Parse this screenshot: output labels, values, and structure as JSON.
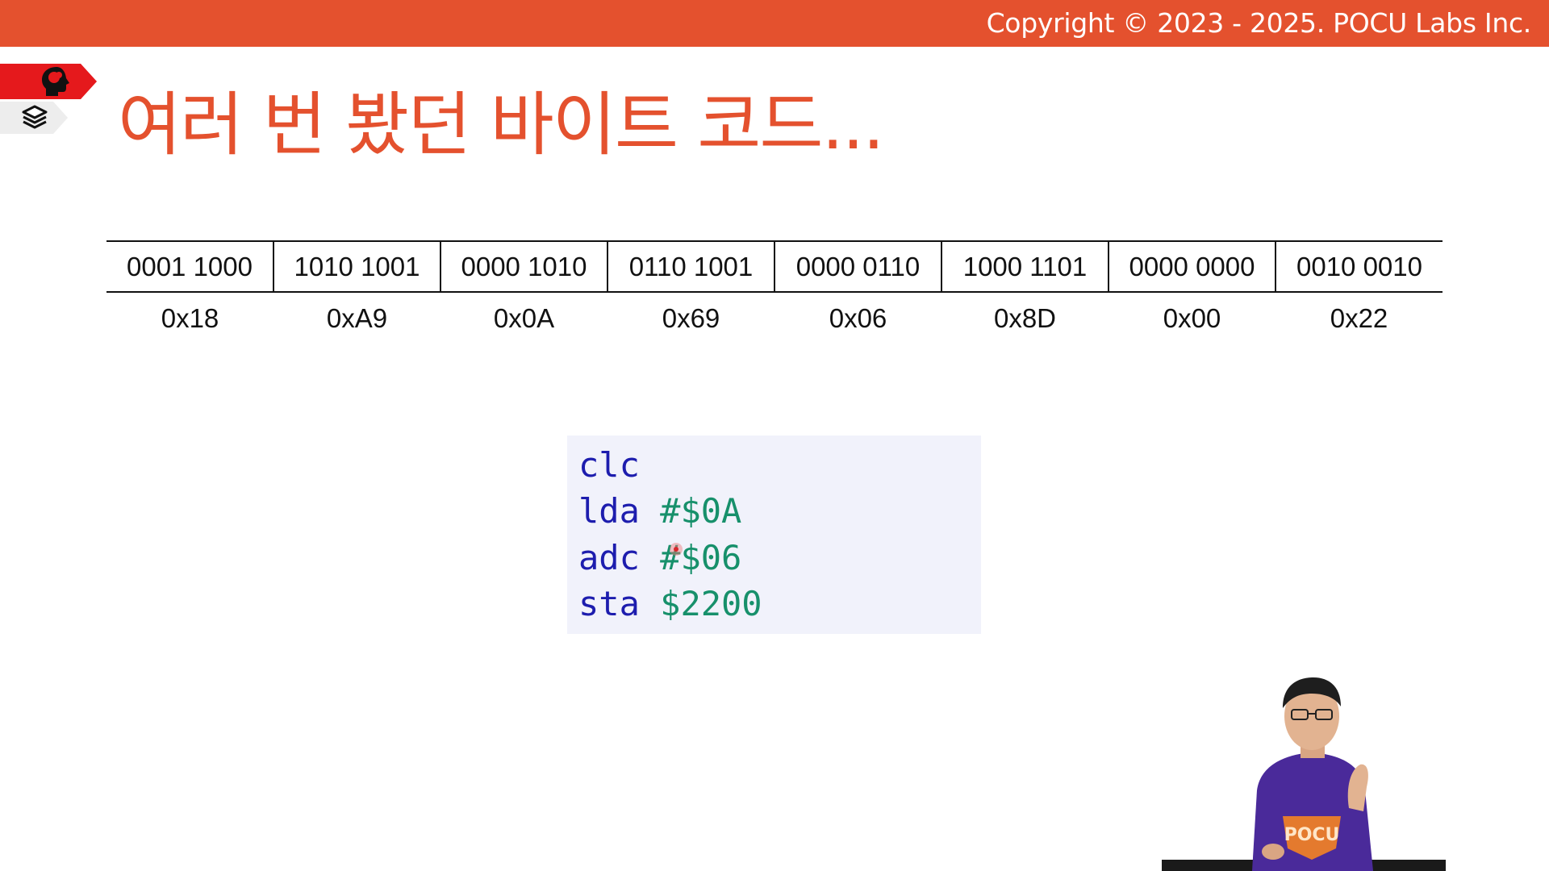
{
  "header": {
    "copyright": "Copyright © 2023 - 2025. POCU Labs Inc.",
    "bar_color": "#E4512E"
  },
  "nav": {
    "tabs": [
      {
        "icon": "brain-head-icon",
        "color": "#E5191C"
      },
      {
        "icon": "layers-stack-icon",
        "color": "#EDEDED"
      }
    ]
  },
  "slide": {
    "title": "여러 번 봤던 바이트 코드...",
    "title_color": "#E4512E"
  },
  "bytes": [
    {
      "binary": "0001 1000",
      "hex": "0x18"
    },
    {
      "binary": "1010 1001",
      "hex": "0xA9"
    },
    {
      "binary": "0000 1010",
      "hex": "0x0A"
    },
    {
      "binary": "0110 1001",
      "hex": "0x69"
    },
    {
      "binary": "0000 0110",
      "hex": "0x06"
    },
    {
      "binary": "1000 1101",
      "hex": "0x8D"
    },
    {
      "binary": "0000 0000",
      "hex": "0x00"
    },
    {
      "binary": "0010 0010",
      "hex": "0x22"
    }
  ],
  "code": [
    {
      "mnemonic": "clc",
      "operand": ""
    },
    {
      "mnemonic": "lda",
      "operand": "#$0A"
    },
    {
      "mnemonic": "adc",
      "operand": "#$06"
    },
    {
      "mnemonic": "sta",
      "operand": "$2200"
    }
  ],
  "code_colors": {
    "mnemonic": "#1D1DAE",
    "operand": "#17906B",
    "background": "#F1F2FB"
  },
  "presenter": {
    "shirt_text": "POCU"
  }
}
